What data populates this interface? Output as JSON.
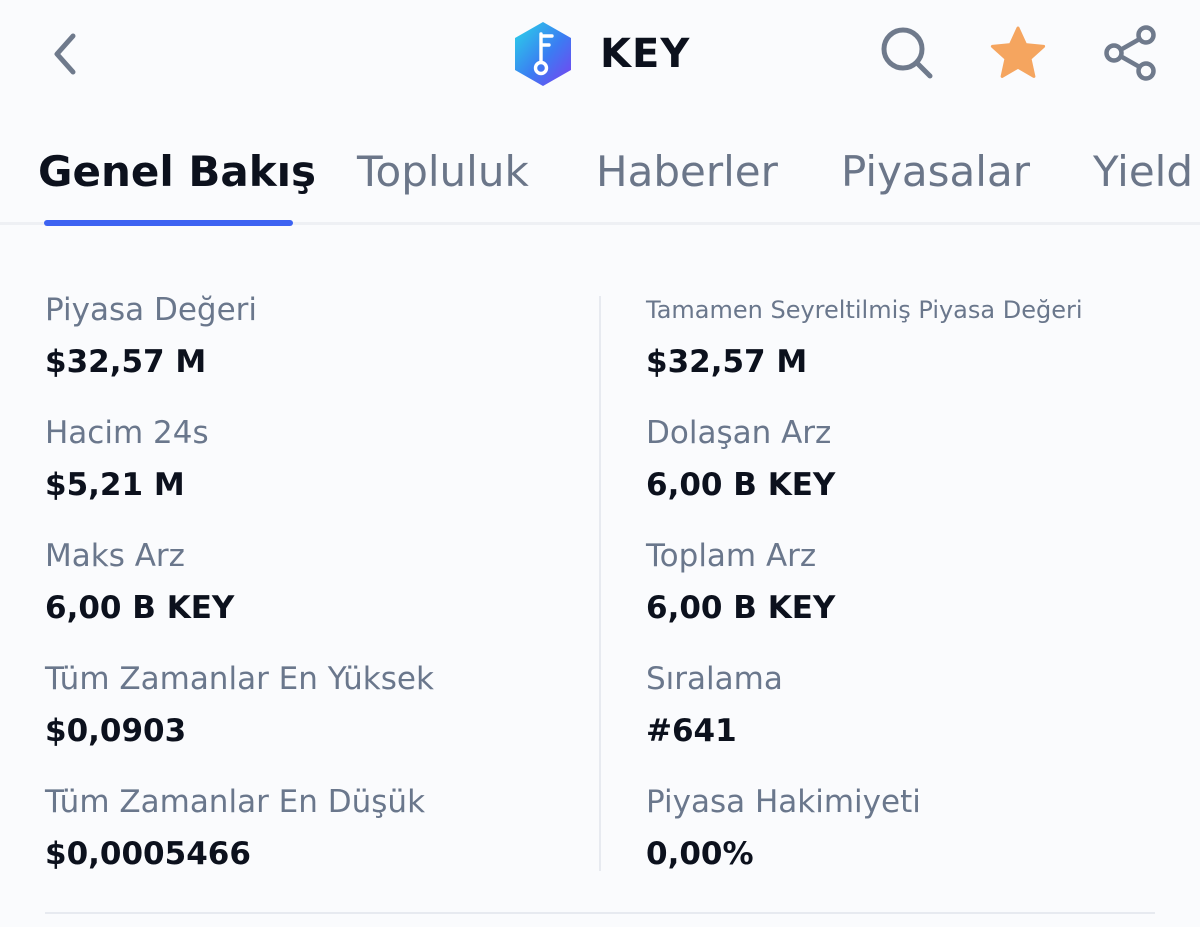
{
  "header": {
    "coin_name": "KEY",
    "icons": {
      "back": "chevron-left-icon",
      "search": "search-icon",
      "favorite": "star-icon",
      "share": "share-icon"
    },
    "favorite_color": "#f5a55f"
  },
  "tabs": [
    {
      "label": "Genel Bakış",
      "active": true
    },
    {
      "label": "Topluluk",
      "active": false
    },
    {
      "label": "Haberler",
      "active": false
    },
    {
      "label": "Piyasalar",
      "active": false
    },
    {
      "label": "Yield",
      "active": false
    }
  ],
  "accent_color": "#3d63f2",
  "stats": {
    "left": [
      {
        "label": "Piyasa Değeri",
        "value": "$32,57 M"
      },
      {
        "label": "Hacim 24s",
        "value": "$5,21 M"
      },
      {
        "label": "Maks Arz",
        "value": "6,00 B KEY"
      },
      {
        "label": "Tüm Zamanlar En Yüksek",
        "value": "$0,0903"
      },
      {
        "label": "Tüm Zamanlar En Düşük",
        "value": "$0,0005466"
      }
    ],
    "right": [
      {
        "label": "Tamamen Seyreltilmiş Piyasa Değeri",
        "value": "$32,57 M"
      },
      {
        "label": "Dolaşan Arz",
        "value": "6,00 B KEY"
      },
      {
        "label": "Toplam Arz",
        "value": "6,00 B KEY"
      },
      {
        "label": "Sıralama",
        "value": "#641"
      },
      {
        "label": "Piyasa Hakimiyeti",
        "value": "0,00%"
      }
    ]
  }
}
